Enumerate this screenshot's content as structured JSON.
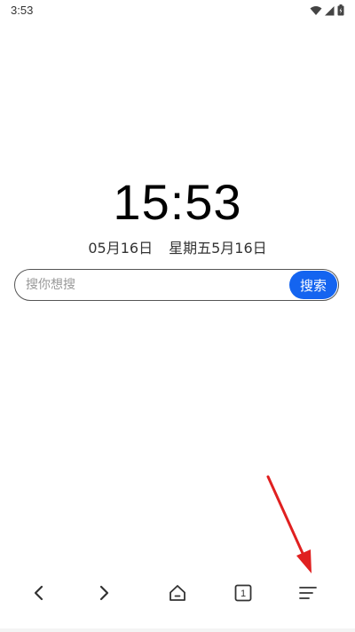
{
  "status_bar": {
    "time": "3:53",
    "icons": [
      "wifi-icon",
      "signal-icon",
      "battery-icon"
    ]
  },
  "clock": {
    "time": "15:53",
    "date": "05月16日",
    "lunar": "星期五5月16日"
  },
  "search": {
    "placeholder": "搜你想搜",
    "button_label": "搜索",
    "accent": "#1464f0"
  },
  "bottom_nav": {
    "items": [
      "back-icon",
      "forward-icon",
      "home-icon",
      "tabs-icon",
      "menu-icon"
    ],
    "tab_count": "1"
  },
  "annotation_color": "#e02020"
}
